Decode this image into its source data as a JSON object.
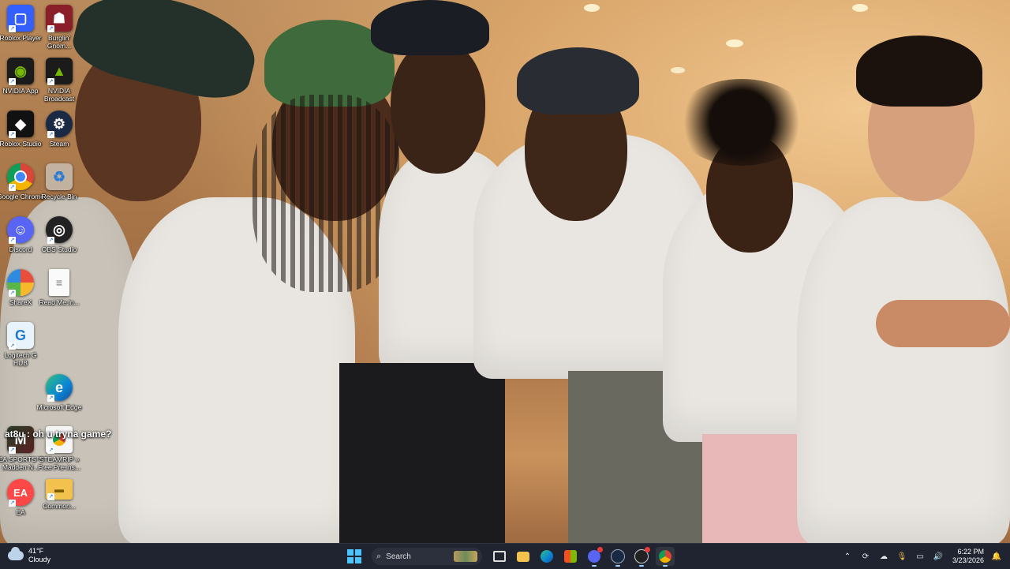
{
  "desktop": {
    "icons": [
      {
        "label": "Roblox Player",
        "icon": "roblox-player-icon"
      },
      {
        "label": "Burglin' Gnom...",
        "icon": "burglin-gnomes-icon"
      },
      {
        "label": "NVIDIA App",
        "icon": "nvidia-app-icon"
      },
      {
        "label": "NVIDIA Broadcast",
        "icon": "nvidia-broadcast-icon"
      },
      {
        "label": "Roblox Studio",
        "icon": "roblox-studio-icon"
      },
      {
        "label": "Steam",
        "icon": "steam-icon"
      },
      {
        "label": "Google Chrome",
        "icon": "chrome-icon"
      },
      {
        "label": "Recycle Bin",
        "icon": "recycle-bin-icon"
      },
      {
        "label": "Discord",
        "icon": "discord-icon"
      },
      {
        "label": "OBS Studio",
        "icon": "obs-icon"
      },
      {
        "label": "ShareX",
        "icon": "sharex-icon"
      },
      {
        "label": "Read Me.In...",
        "icon": "text-file-icon"
      },
      {
        "label": "Logitech G HUB",
        "icon": "logitech-ghub-icon"
      },
      {
        "label": "Microsoft Edge",
        "icon": "edge-icon"
      },
      {
        "label": "EA SPORTS™ Madden N...",
        "icon": "madden-icon"
      },
      {
        "label": "STEAMRIP » Free Pre-ins...",
        "icon": "chrome-shortcut-icon"
      },
      {
        "label": "EA",
        "icon": "ea-icon"
      },
      {
        "label": "Common...",
        "icon": "folder-icon"
      }
    ],
    "overlay_caption": "at8u : oh u tryna game?"
  },
  "taskbar": {
    "weather": {
      "temp": "41°F",
      "condition": "Cloudy",
      "icon": "cloud-icon"
    },
    "search_placeholder": "Search",
    "pinned": [
      {
        "name": "start-button",
        "icon": "windows-icon"
      },
      {
        "name": "task-view",
        "icon": "task-view-icon"
      },
      {
        "name": "file-explorer",
        "icon": "folder-icon"
      },
      {
        "name": "edge",
        "icon": "edge-icon"
      },
      {
        "name": "microsoft-store",
        "icon": "store-icon"
      },
      {
        "name": "discord",
        "icon": "discord-icon"
      },
      {
        "name": "steam",
        "icon": "steam-icon"
      },
      {
        "name": "obs",
        "icon": "obs-icon"
      },
      {
        "name": "chrome",
        "icon": "chrome-icon"
      }
    ],
    "clock": {
      "time": "6:22 PM",
      "date": "3/23/2026"
    },
    "colors": {
      "accent": "#4cc2ff",
      "taskbar_bg": "#1f2430"
    }
  }
}
